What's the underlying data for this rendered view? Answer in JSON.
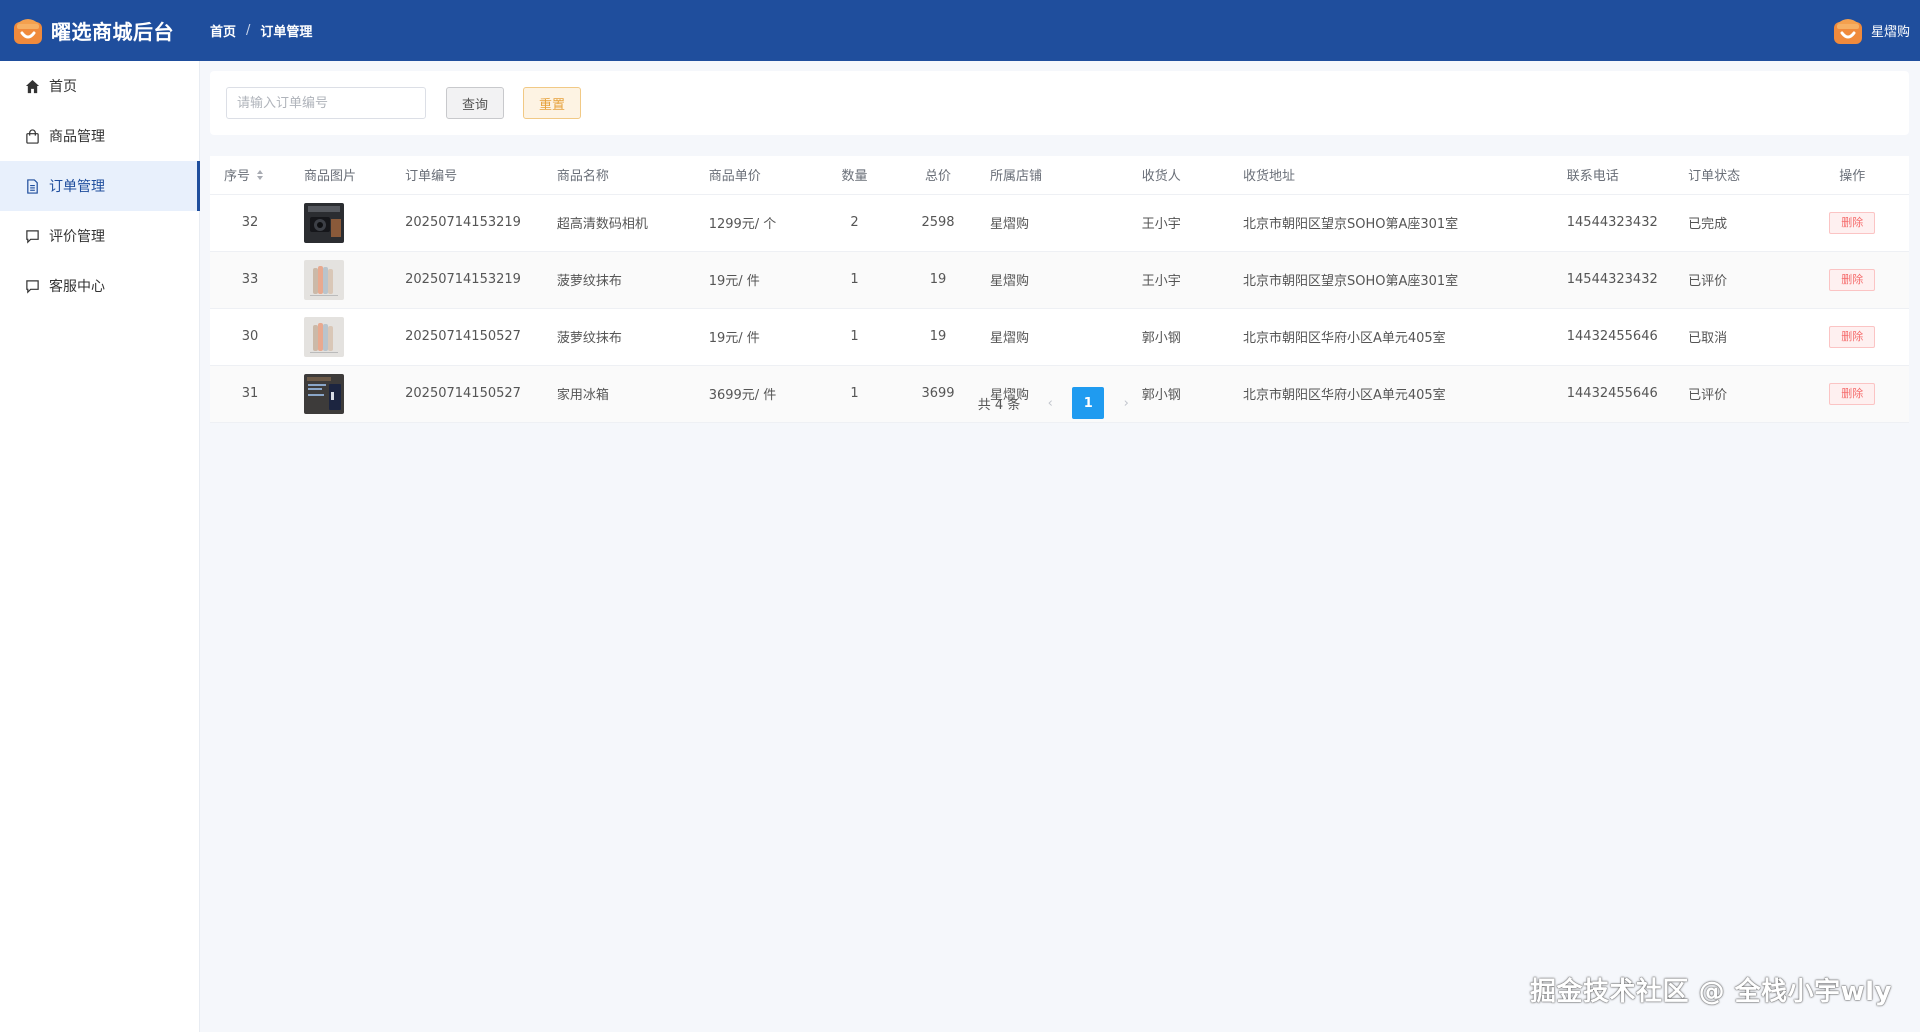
{
  "header": {
    "brand_title": "曜选商城后台",
    "breadcrumb": [
      "首页",
      "订单管理"
    ],
    "breadcrumb_sep": "/",
    "user_name": "星熠购"
  },
  "sidebar": {
    "items": [
      {
        "label": "首页",
        "icon": "home-icon",
        "active": false
      },
      {
        "label": "商品管理",
        "icon": "shopping-bag-icon",
        "active": false
      },
      {
        "label": "订单管理",
        "icon": "document-icon",
        "active": true
      },
      {
        "label": "评价管理",
        "icon": "chat-bubble-icon",
        "active": false
      },
      {
        "label": "客服中心",
        "icon": "chat-bubble-icon",
        "active": false
      }
    ]
  },
  "search": {
    "placeholder": "请输入订单编号",
    "value": "",
    "query_label": "查询",
    "reset_label": "重置"
  },
  "table": {
    "headers": [
      "序号",
      "商品图片",
      "订单编号",
      "商品名称",
      "商品单价",
      "数量",
      "总价",
      "所属店铺",
      "收货人",
      "收货地址",
      "联系电话",
      "订单状态",
      "操作"
    ],
    "rows": [
      {
        "id": "32",
        "image": "camera-photo",
        "order_no": "20250714153219",
        "name": "超高清数码相机",
        "unit_price": "1299元/ 个",
        "qty": "2",
        "total": "2598",
        "shop": "星熠购",
        "receiver": "王小宇",
        "address": "北京市朝阳区望京SOHO第A座301室",
        "phone": "14544323432",
        "status": "已完成",
        "action": "删除"
      },
      {
        "id": "33",
        "image": "towel-photo",
        "order_no": "20250714153219",
        "name": "菠萝纹抹布",
        "unit_price": "19元/ 件",
        "qty": "1",
        "total": "19",
        "shop": "星熠购",
        "receiver": "王小宇",
        "address": "北京市朝阳区望京SOHO第A座301室",
        "phone": "14544323432",
        "status": "已评价",
        "action": "删除"
      },
      {
        "id": "30",
        "image": "towel-photo",
        "order_no": "20250714150527",
        "name": "菠萝纹抹布",
        "unit_price": "19元/ 件",
        "qty": "1",
        "total": "19",
        "shop": "星熠购",
        "receiver": "郭小钢",
        "address": "北京市朝阳区华府小区A单元405室",
        "phone": "14432455646",
        "status": "已取消",
        "action": "删除"
      },
      {
        "id": "31",
        "image": "fridge-photo",
        "order_no": "20250714150527",
        "name": "家用冰箱",
        "unit_price": "3699元/ 件",
        "qty": "1",
        "total": "3699",
        "shop": "星熠购",
        "receiver": "郭小钢",
        "address": "北京市朝阳区华府小区A单元405室",
        "phone": "14432455646",
        "status": "已评价",
        "action": "删除"
      }
    ]
  },
  "pagination": {
    "total_text": "共 4 条",
    "current_page": "1",
    "prev": "‹",
    "next": "›"
  },
  "watermark": "掘金技术社区 @ 全栈小宇wly",
  "colors": {
    "header_bg": "#1f4e9d",
    "active_page": "#1f9bf0",
    "delete": "#f56c6c",
    "reset": "#e6a23c"
  }
}
